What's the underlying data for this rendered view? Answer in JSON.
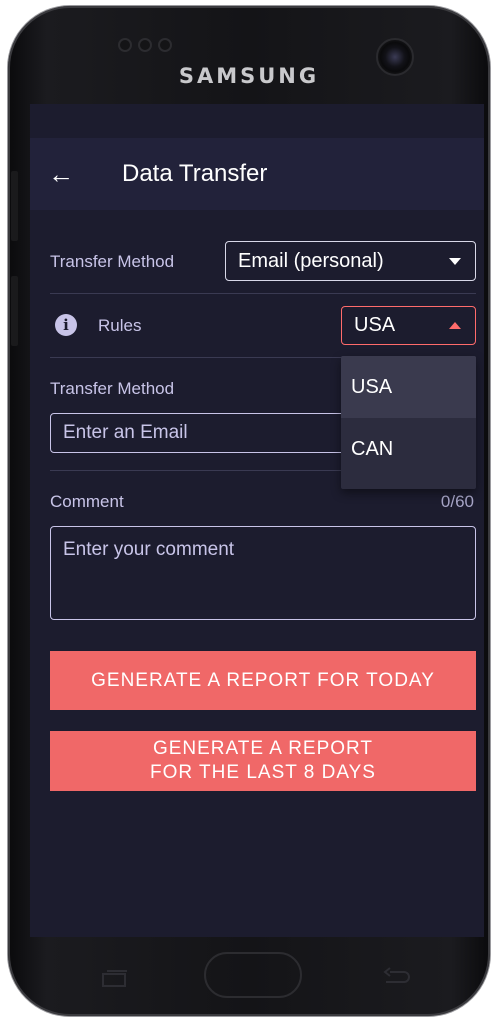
{
  "device": {
    "brand": "SAMSUNG"
  },
  "appbar": {
    "title": "Data Transfer",
    "back_icon": "arrow-left-icon"
  },
  "form": {
    "transfer_method_label": "Transfer Method",
    "transfer_method_value": "Email (personal)",
    "rules_label": "Rules",
    "rules_value": "USA",
    "rules_options": [
      "USA",
      "CAN"
    ],
    "email_label": "Transfer Method",
    "email_placeholder": "Enter an Email",
    "comment_label": "Comment",
    "comment_counter": "0/60",
    "comment_placeholder": "Enter your comment"
  },
  "buttons": {
    "today": "GENERATE A REPORT FOR TODAY",
    "last8_line1": "GENERATE A REPORT",
    "last8_line2": "FOR THE LAST 8 DAYS"
  },
  "colors": {
    "accent": "#f06868",
    "background": "#1c1c2e",
    "appbar": "#22223a",
    "error_border": "#ff6b6b"
  }
}
